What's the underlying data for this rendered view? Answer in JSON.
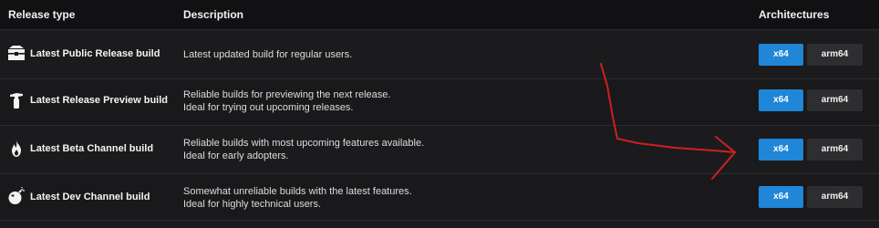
{
  "table": {
    "headers": {
      "release_type": "Release type",
      "description": "Description",
      "architectures": "Architectures"
    },
    "rows": [
      {
        "icon": "box-icon",
        "name": "Latest Public Release build",
        "description": [
          "Latest updated build for regular users."
        ],
        "x64": "x64",
        "arm64": "arm64"
      },
      {
        "icon": "fire-extinguisher-icon",
        "name": "Latest Release Preview build",
        "description": [
          "Reliable builds for previewing the next release.",
          "Ideal for trying out upcoming releases."
        ],
        "x64": "x64",
        "arm64": "arm64"
      },
      {
        "icon": "flame-icon",
        "name": "Latest Beta Channel build",
        "description": [
          "Reliable builds with most upcoming features available.",
          "Ideal for early adopters."
        ],
        "x64": "x64",
        "arm64": "arm64"
      },
      {
        "icon": "bomb-icon",
        "name": "Latest Dev Channel build",
        "description": [
          "Somewhat unreliable builds with the latest features.",
          "Ideal for highly technical users."
        ],
        "x64": "x64",
        "arm64": "arm64"
      }
    ]
  },
  "colors": {
    "x64_button": "#1f86d8",
    "arm64_button": "#2e2e31",
    "annotation_arrow": "#d21f1f"
  }
}
